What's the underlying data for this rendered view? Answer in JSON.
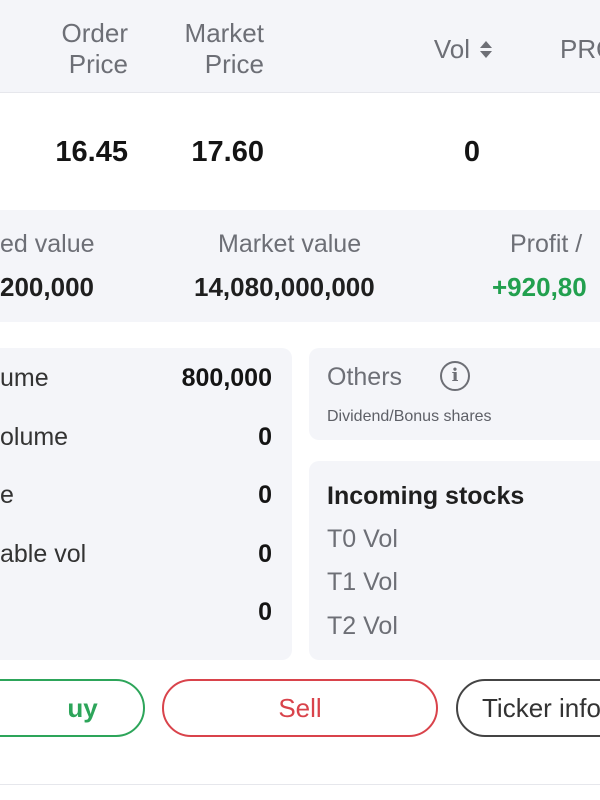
{
  "header": {
    "order_price": "Order\nPrice",
    "market_price": "Market\nPrice",
    "vol": "Vol",
    "pro": "PRO"
  },
  "row": {
    "order_price": "16.45",
    "market_price": "17.60",
    "vol": "0"
  },
  "summary": {
    "cost_label": "ed value",
    "cost_value": "200,000",
    "market_label": "Market value",
    "market_value": "14,080,000,000",
    "profit_label": "Profit /",
    "profit_value": "+920,80"
  },
  "volume_card": {
    "rows": [
      {
        "label": "ume",
        "value": "800,000"
      },
      {
        "label": "olume",
        "value": "0"
      },
      {
        "label": "e",
        "value": "0"
      },
      {
        "label": "able vol",
        "value": "0"
      },
      {
        "label": "",
        "value": "0"
      }
    ]
  },
  "others": {
    "title": "Others",
    "info_glyph": "i",
    "subtitle": "Dividend/Bonus shares"
  },
  "incoming": {
    "title": "Incoming stocks",
    "rows": [
      "T0 Vol",
      "T1 Vol",
      "T2 Vol"
    ]
  },
  "buttons": {
    "buy": "uy",
    "sell": "Sell",
    "ticker": "Ticker info"
  },
  "colors": {
    "profit": "#22a04f",
    "buy": "#2da55a",
    "sell": "#d9434b",
    "panel_bg": "#f4f5f9"
  },
  "icons": {
    "sort": "sort-icon",
    "info": "info-icon"
  }
}
